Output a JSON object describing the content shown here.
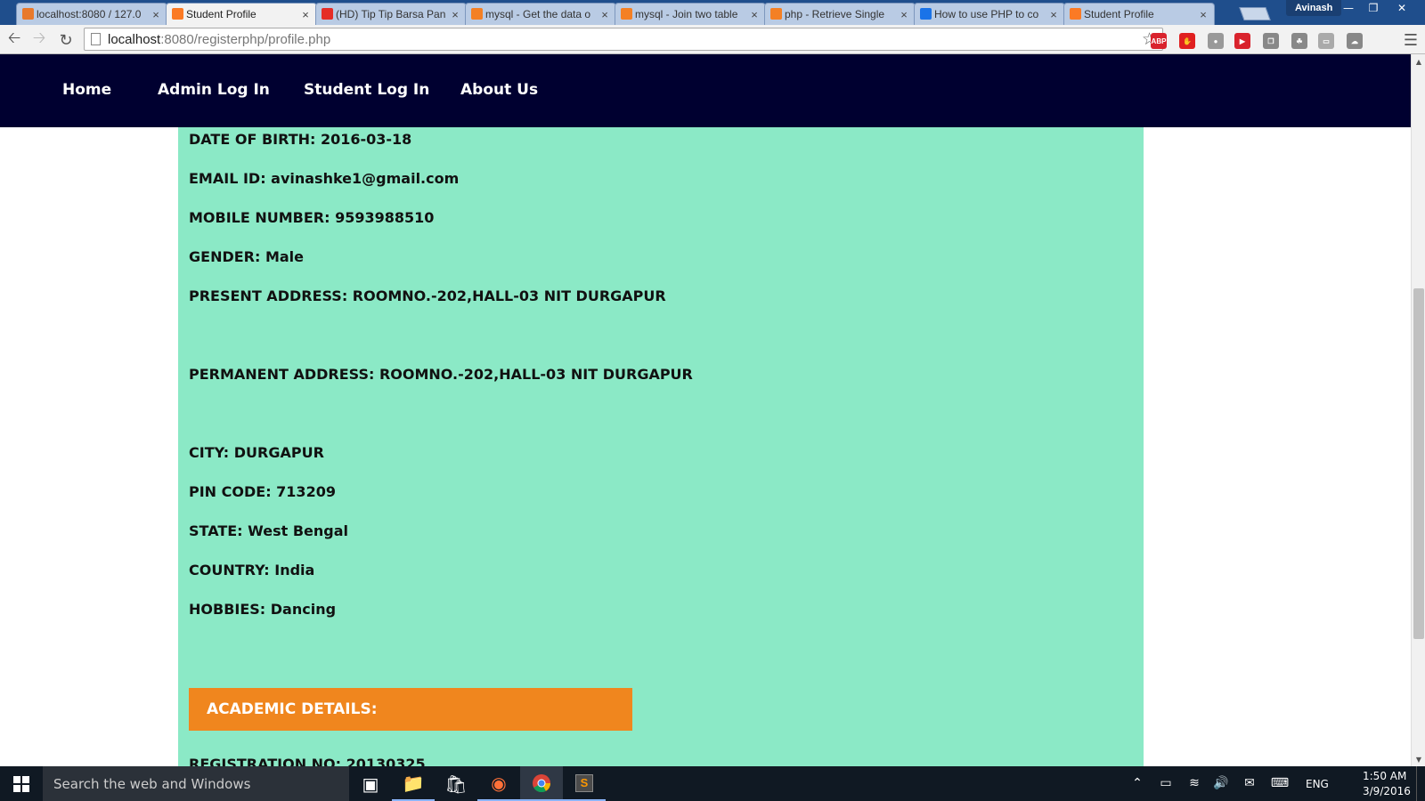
{
  "browser": {
    "tabs": [
      {
        "label": "localhost:8080 / 127.0",
        "icon": "phpmyadmin-icon",
        "color": "#e8792b"
      },
      {
        "label": "Student Profile",
        "icon": "xampp-icon",
        "color": "#fb7a24",
        "active": true
      },
      {
        "label": "(HD) Tip Tip Barsa Pan",
        "icon": "youtube-icon",
        "color": "#e52d27"
      },
      {
        "label": "mysql - Get the data o",
        "icon": "stackoverflow-icon",
        "color": "#f48024"
      },
      {
        "label": "mysql - Join two table",
        "icon": "stackoverflow-icon",
        "color": "#f48024"
      },
      {
        "label": "php - Retrieve Single",
        "icon": "stackoverflow-icon",
        "color": "#f48024"
      },
      {
        "label": "How to use PHP to co",
        "icon": "loading-icon",
        "color": "#1a73e8"
      },
      {
        "label": "Student Profile",
        "icon": "xampp-icon",
        "color": "#fb7a24"
      }
    ],
    "profile_name": "Avinash",
    "url_host": "localhost",
    "url_path": ":8080/registerphp/profile.php",
    "extensions": [
      "abp-icon",
      "stop-icon",
      "bulb-icon",
      "video-icon",
      "copy-icon",
      "leaf-icon",
      "card-icon",
      "cloud-icon"
    ]
  },
  "site": {
    "nav": [
      "Home",
      "Admin Log In",
      "Student Log In",
      "About Us"
    ]
  },
  "profile": {
    "fields": [
      {
        "text": "DATE OF BIRTH: 2016-03-18"
      },
      {
        "text": "EMAIL ID: avinashke1@gmail.com"
      },
      {
        "text": "MOBILE NUMBER: 9593988510"
      },
      {
        "text": "GENDER: Male"
      },
      {
        "text": "PRESENT ADDRESS: ROOMNO.-202,HALL-03 NIT DURGAPUR"
      },
      {
        "text": "PERMANENT ADDRESS: ROOMNO.-202,HALL-03 NIT DURGAPUR"
      },
      {
        "text": "CITY: DURGAPUR"
      },
      {
        "text": "PIN CODE: 713209"
      },
      {
        "text": "STATE: West Bengal"
      },
      {
        "text": "COUNTRY: India"
      },
      {
        "text": "HOBBIES: Dancing"
      }
    ],
    "section_header": "ACADEMIC DETAILS:",
    "partial_field": "REGISTRATION NO: 20130325"
  },
  "taskbar": {
    "search_placeholder": "Search the web and Windows",
    "apps": [
      "task-view-icon",
      "file-explorer-icon",
      "store-icon",
      "firefox-icon",
      "chrome-icon",
      "sublime-text-icon"
    ],
    "language": "ENG",
    "time": "1:50 AM",
    "date": "3/9/2016"
  },
  "colors": {
    "nav_bg": "#000030",
    "panel_bg": "#8be9c6",
    "section_header_bg": "#f0861e"
  }
}
